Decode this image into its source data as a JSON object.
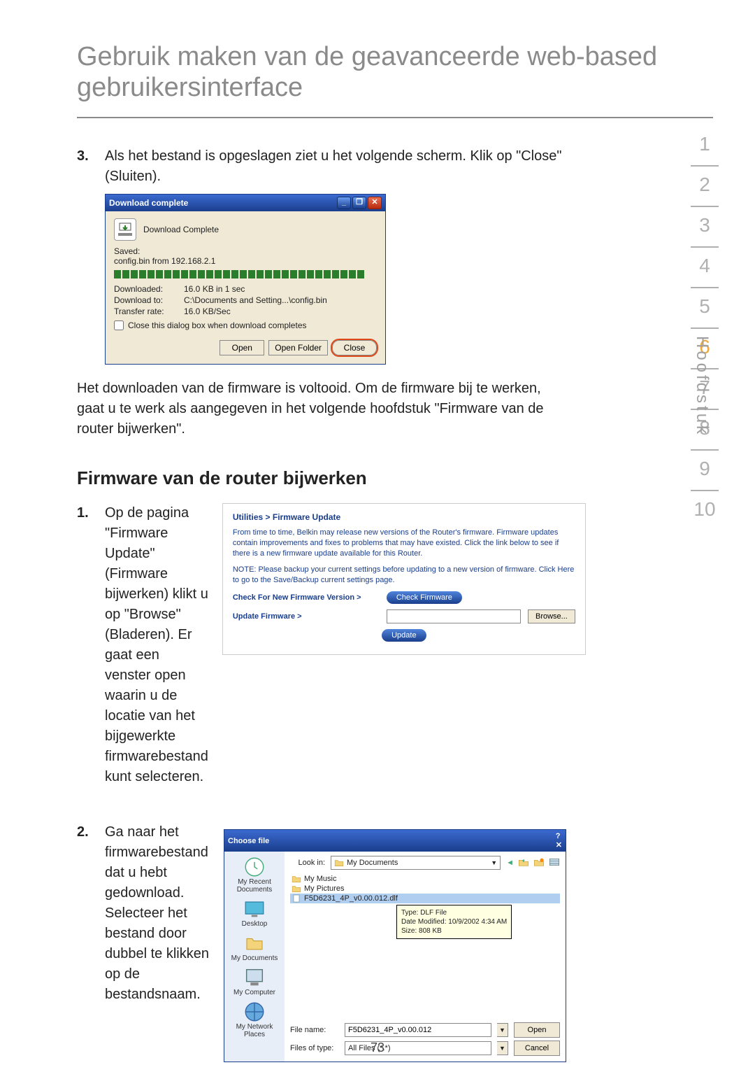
{
  "title": "Gebruik maken van de geavanceerde web-based gebruikersinterface",
  "chapter_sidebar": {
    "label": "Hoofdstuk",
    "items": [
      "1",
      "2",
      "3",
      "4",
      "5",
      "6",
      "7",
      "8",
      "9",
      "10"
    ],
    "active_index": 5
  },
  "step3": {
    "num": "3.",
    "text": "Als het bestand is opgeslagen ziet u het volgende scherm. Klik op \"Close\" (Sluiten)."
  },
  "download_dialog": {
    "title": "Download complete",
    "status": "Download Complete",
    "saved_label": "Saved:",
    "saved_value": "config.bin from 192.168.2.1",
    "rows": {
      "downloaded": {
        "k": "Downloaded:",
        "v": "16.0 KB in 1 sec"
      },
      "download_to": {
        "k": "Download to:",
        "v": "C:\\Documents and Setting...\\config.bin"
      },
      "transfer_rate": {
        "k": "Transfer rate:",
        "v": "16.0 KB/Sec"
      }
    },
    "close_checkbox": "Close this dialog box when download completes",
    "buttons": {
      "open": "Open",
      "open_folder": "Open Folder",
      "close": "Close"
    },
    "window_buttons": {
      "min": "_",
      "max": "❐",
      "close": "✕"
    }
  },
  "after_download_text": "Het downloaden van de firmware is voltooid. Om de firmware bij te werken, gaat u te werk als aangegeven in het volgende hoofdstuk \"Firmware van de router bijwerken\".",
  "subhead": "Firmware van de router bijwerken",
  "step1": {
    "num": "1.",
    "text": "Op de pagina \"Firmware Update\" (Firmware bijwerken) klikt u op \"Browse\" (Bladeren). Er gaat een venster open waarin u de locatie van het bijgewerkte firmwarebestand kunt selecteren."
  },
  "firmware_panel": {
    "breadcrumb": "Utilities > Firmware Update",
    "p1": "From time to time, Belkin may release new versions of the Router's firmware. Firmware updates contain improvements and fixes to problems that may have existed. Click the link below to see if there is a new firmware update available for this Router.",
    "p2": "NOTE: Please backup your current settings before updating to a new version of firmware. Click Here to go to the Save/Backup current settings page.",
    "row_check": {
      "label": "Check For New Firmware Version >",
      "button": "Check Firmware"
    },
    "row_update": {
      "label": "Update Firmware >",
      "button": "Browse..."
    },
    "update_button": "Update"
  },
  "step2": {
    "num": "2.",
    "text": "Ga naar het firmwarebestand dat u hebt gedownload. Selecteer het bestand door dubbel te klikken op de bestandsnaam."
  },
  "file_dialog": {
    "title": "Choose file",
    "window_buttons": {
      "help": "?",
      "close": "✕"
    },
    "look_in_label": "Look in:",
    "look_in_value": "My Documents",
    "toolbar_icons": [
      "back-icon",
      "up-icon",
      "new-folder-icon",
      "views-icon"
    ],
    "places": [
      "My Recent Documents",
      "Desktop",
      "My Documents",
      "My Computer",
      "My Network Places"
    ],
    "items": [
      {
        "name": "My Music",
        "selected": false
      },
      {
        "name": "My Pictures",
        "selected": false
      },
      {
        "name": "F5D6231_4P_v0.00.012.dlf",
        "selected": true
      }
    ],
    "tooltip": {
      "type": "Type: DLF File",
      "modified": "Date Modified: 10/9/2002 4:34 AM",
      "size": "Size: 808 KB"
    },
    "file_name_label": "File name:",
    "file_name_value": "F5D6231_4P_v0.00.012",
    "files_of_type_label": "Files of type:",
    "files_of_type_value": "All Files (*.*)",
    "open": "Open",
    "cancel": "Cancel"
  },
  "page_number": "73"
}
